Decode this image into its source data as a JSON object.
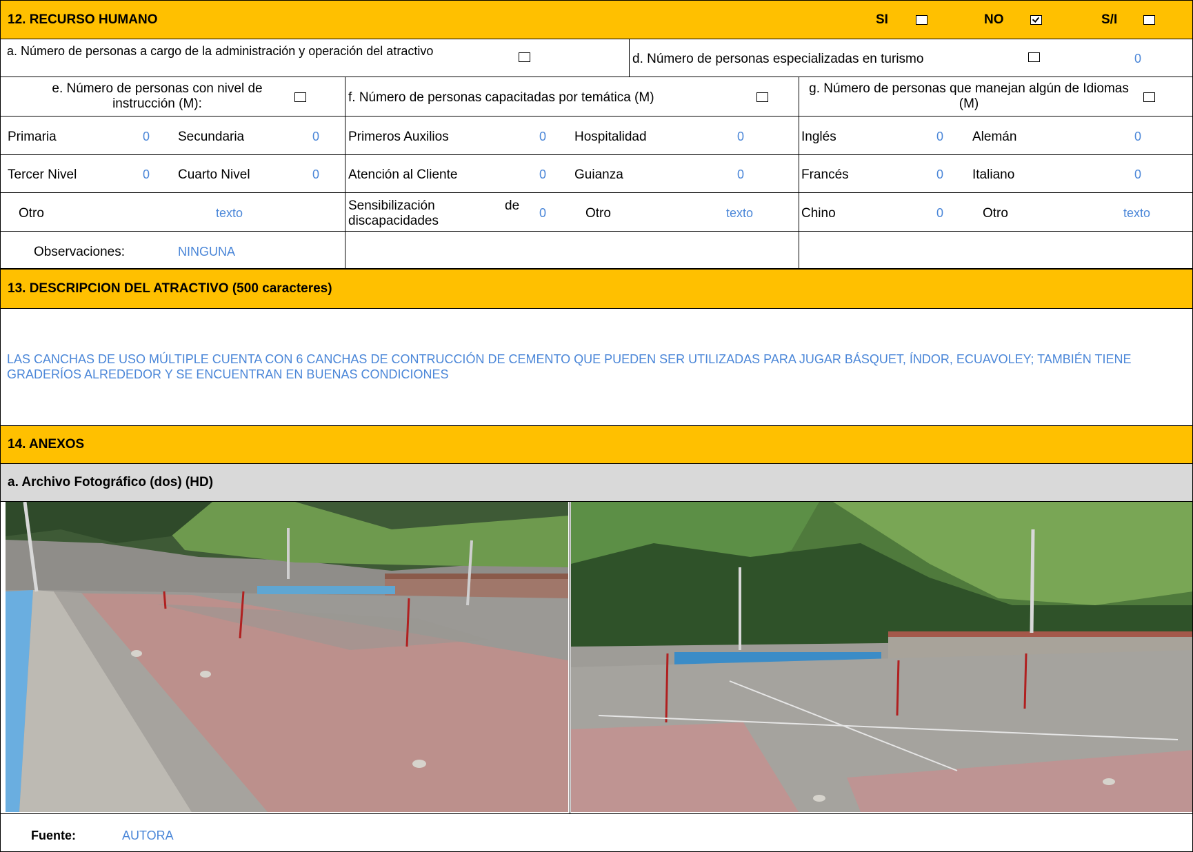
{
  "section12": {
    "title": "12. RECURSO HUMANO",
    "si_label": "SI",
    "no_label": "NO",
    "si_checked": false,
    "no_checked": true,
    "sn_label": "S/I",
    "sn_checked": false
  },
  "row_a": {
    "label_a": "a. Número de personas a cargo de la administración y operación del atractivo",
    "label_d": "d. Número de personas especializadas en turismo",
    "value_d": "0"
  },
  "row_efg": {
    "label_e": "e. Número de personas con nivel de instrucción (M):",
    "label_f": "f. Número de personas capacitadas por temática (M)",
    "label_g": "g. Número de personas que manejan algún de Idiomas (M)"
  },
  "grid": {
    "r1": {
      "c1": "Primaria",
      "v1": "0",
      "c2": "Secundaria",
      "v2": "0",
      "c3": "Primeros Auxilios",
      "v3": "0",
      "c4": "Hospitalidad",
      "v4": "0",
      "c5": "Inglés",
      "v5": "0",
      "c6": "Alemán",
      "v6": "0"
    },
    "r2": {
      "c1": "Tercer Nivel",
      "v1": "0",
      "c2": "Cuarto Nivel",
      "v2": "0",
      "c3": "Atención al Cliente",
      "v3": "0",
      "c4": "Guianza",
      "v4": "0",
      "c5": "Francés",
      "v5": "0",
      "c6": "Italiano",
      "v6": "0"
    },
    "r3": {
      "c1": "Otro",
      "v1": "texto",
      "c3a": "Sensibilización",
      "c3b": "de",
      "c3c": "discapacidades",
      "v3": "0",
      "c4": "Otro",
      "v4": "texto",
      "c5": "Chino",
      "v5": "0",
      "c6": "Otro",
      "v6": "texto"
    }
  },
  "observaciones": {
    "label": "Observaciones:",
    "value": "NINGUNA"
  },
  "section13": {
    "title": "13. DESCRIPCION DEL ATRACTIVO (500 caracteres)",
    "text": "LAS CANCHAS DE USO MÚLTIPLE CUENTA CON 6 CANCHAS DE CONTRUCCIÓN DE CEMENTO QUE PUEDEN SER UTILIZADAS PARA JUGAR BÁSQUET, ÍNDOR, ECUAVOLEY; TAMBIÉN TIENE GRADERÍOS ALREDEDOR Y SE ENCUENTRAN EN BUENAS CONDICIONES"
  },
  "section14": {
    "title": "14. ANEXOS",
    "subtitle": "a. Archivo Fotográfico (dos) (HD)"
  },
  "fuente": {
    "label": "Fuente:",
    "value": "AUTORA"
  },
  "colors": {
    "band": "#FFC000",
    "blue_value": "#4a86d8",
    "sub_band": "#D9D9D9"
  }
}
